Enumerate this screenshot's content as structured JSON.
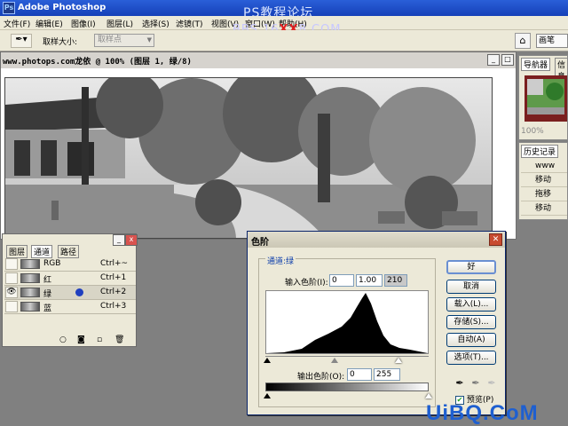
{
  "app": {
    "title": "Adobe Photoshop"
  },
  "watermark": {
    "top_line": "PS教程论坛",
    "bbs_prefix": "BBS.16",
    "bbs_highlight": "XX",
    "bbs_suffix": "8.COM",
    "bottom_brand": "UiBQ.CoM"
  },
  "menu": [
    "文件(F)",
    "编辑(E)",
    "图像(I)",
    "图层(L)",
    "选择(S)",
    "滤镜(T)",
    "视图(V)",
    "窗口(W)",
    "帮助(H)"
  ],
  "options": {
    "sample_size_label": "取样大小:",
    "sample_size_value": "取样点",
    "panel_well": "画笔"
  },
  "document": {
    "title": "www.photops.com龙依 @ 100% (图层 1, 绿/8)"
  },
  "navigator": {
    "tabs": [
      "导航器",
      "信息"
    ],
    "zoom": "100%"
  },
  "history": {
    "tab": "历史记录",
    "rows": [
      "www",
      "移动",
      "拖移",
      "移动"
    ]
  },
  "channels": {
    "tabs": [
      "图层",
      "通道",
      "路径"
    ],
    "rows": [
      {
        "name": "RGB",
        "shortcut": "Ctrl+~"
      },
      {
        "name": "红",
        "shortcut": "Ctrl+1"
      },
      {
        "name": "绿",
        "shortcut": "Ctrl+2"
      },
      {
        "name": "蓝",
        "shortcut": "Ctrl+3"
      }
    ]
  },
  "levels": {
    "title": "色阶",
    "channel_label": "通道:绿",
    "input_label": "输入色阶(I):",
    "input_values": [
      "0",
      "1.00",
      "210"
    ],
    "output_label": "输出色阶(O):",
    "output_values": [
      "0",
      "255"
    ],
    "buttons": {
      "ok": "好",
      "cancel": "取消",
      "load": "载入(L)...",
      "save": "存储(S)...",
      "auto": "自动(A)",
      "options": "选项(T)..."
    },
    "preview_label": "预览(P)",
    "preview_checked": true
  }
}
